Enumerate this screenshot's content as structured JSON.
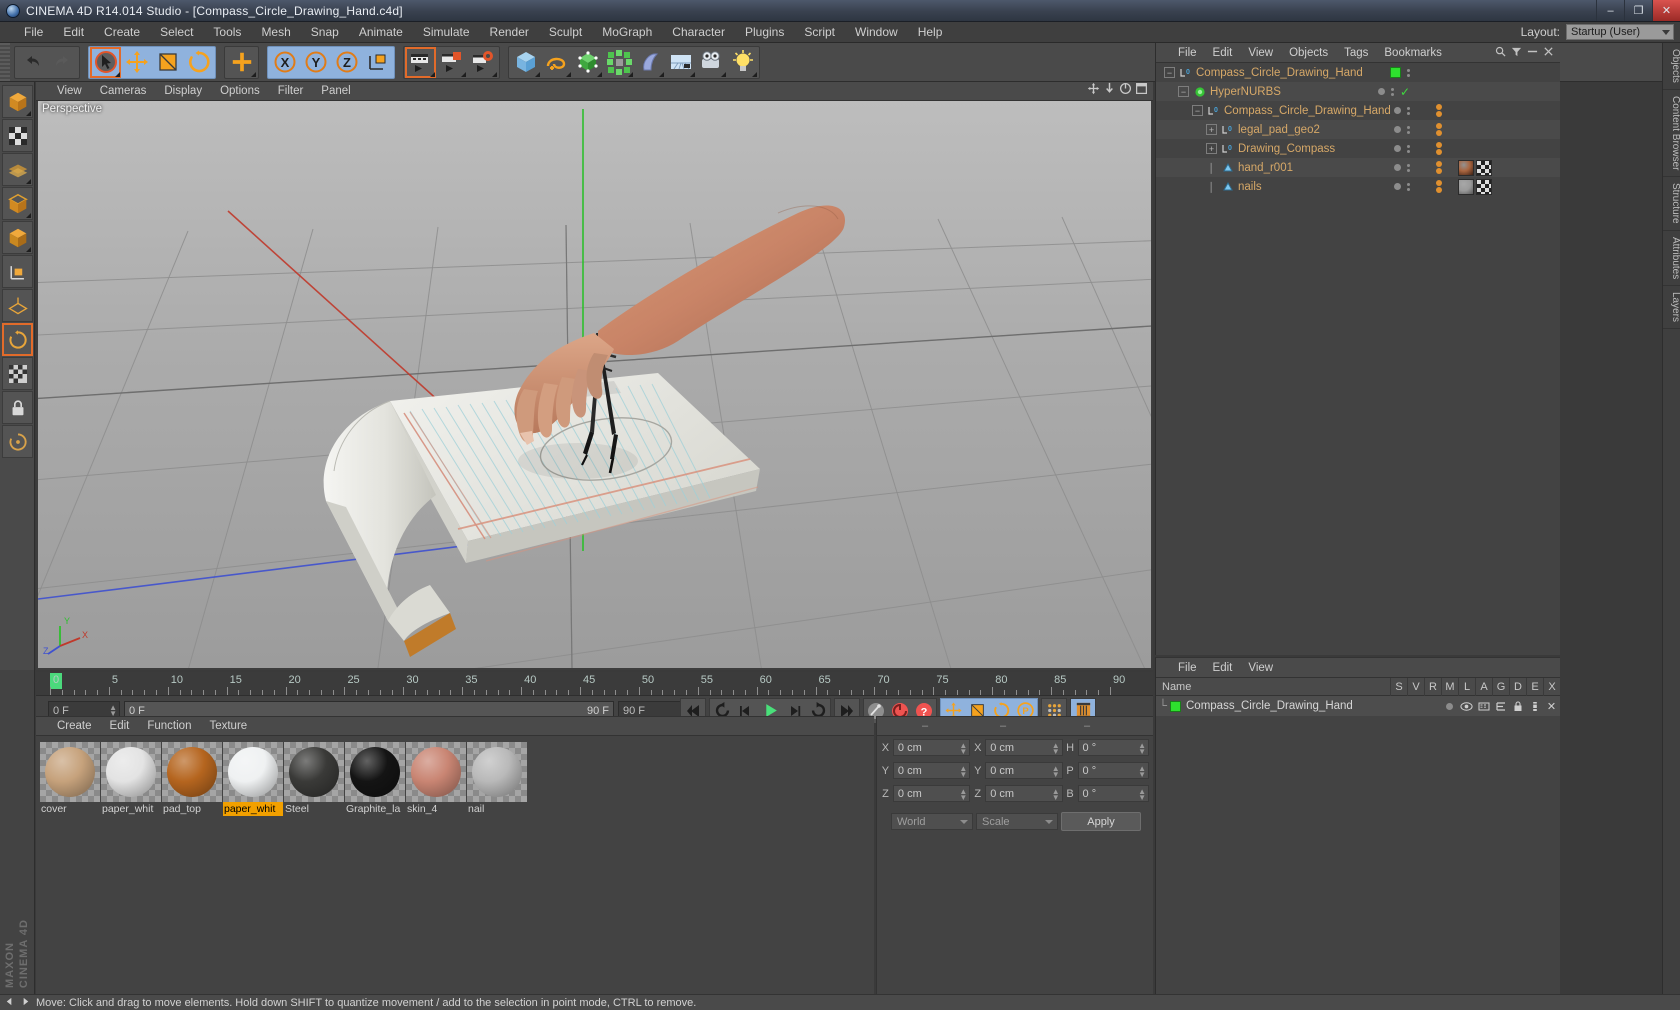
{
  "window": {
    "title": "CINEMA 4D R14.014 Studio - [Compass_Circle_Drawing_Hand.c4d]",
    "app_icon": "c4d-logo-icon",
    "minimize": "–",
    "maximize": "❐",
    "close": "✕"
  },
  "menubar": {
    "items": [
      "File",
      "Edit",
      "Create",
      "Select",
      "Tools",
      "Mesh",
      "Snap",
      "Animate",
      "Simulate",
      "Render",
      "Sculpt",
      "MoGraph",
      "Character",
      "Plugins",
      "Script",
      "Window",
      "Help"
    ],
    "layout_label": "Layout:",
    "layout_value": "Startup (User)"
  },
  "toolbar": {
    "groups": [
      {
        "name": "undo-redo",
        "buttons": [
          {
            "icon": "undo-icon"
          },
          {
            "icon": "redo-icon"
          }
        ]
      },
      {
        "name": "transform",
        "highlight": true,
        "buttons": [
          {
            "icon": "live-selection-icon",
            "selected": true
          },
          {
            "icon": "move-icon"
          },
          {
            "icon": "scale-icon"
          },
          {
            "icon": "rotate-icon"
          }
        ]
      },
      {
        "name": "add-point",
        "buttons": [
          {
            "icon": "plus-move-icon"
          }
        ]
      },
      {
        "name": "axis-lock",
        "highlight": true,
        "buttons": [
          {
            "icon": "x-axis-icon"
          },
          {
            "icon": "y-axis-icon"
          },
          {
            "icon": "z-axis-icon"
          },
          {
            "icon": "world-axis-icon"
          }
        ]
      },
      {
        "name": "render",
        "buttons": [
          {
            "icon": "render-view-icon",
            "selected": true
          },
          {
            "icon": "render-picture-viewer-icon"
          },
          {
            "icon": "render-settings-icon"
          }
        ]
      },
      {
        "name": "create",
        "buttons": [
          {
            "icon": "cube-primitive-icon"
          },
          {
            "icon": "spline-icon"
          },
          {
            "icon": "nurbs-icon"
          },
          {
            "icon": "mograph-icon"
          },
          {
            "icon": "deformer-icon"
          },
          {
            "icon": "scene-icon"
          },
          {
            "icon": "camera-icon"
          },
          {
            "icon": "light-icon"
          }
        ]
      }
    ]
  },
  "left_palette": {
    "buttons": [
      {
        "icon": "model-mode-icon",
        "selected": false
      },
      {
        "icon": "texture-mode-icon",
        "selected": false
      },
      {
        "icon": "points-mode-icon",
        "selected": false
      },
      {
        "icon": "edges-mode-icon",
        "selected": false
      },
      {
        "icon": "polygons-mode-icon",
        "selected": false
      },
      {
        "icon": "object-axis-icon",
        "selected": false
      },
      {
        "icon": "workplane-icon",
        "selected": false
      },
      {
        "icon": "enable-axis-icon",
        "selected": true
      },
      {
        "icon": "viewport-solo-icon",
        "selected": false
      },
      {
        "icon": "lock-icon",
        "selected": false
      },
      {
        "icon": "snap-icon",
        "selected": false
      }
    ]
  },
  "viewport": {
    "menu": [
      "View",
      "Cameras",
      "Display",
      "Options",
      "Filter",
      "Panel"
    ],
    "view_label": "Perspective",
    "corner_icons": [
      "move-camera-icon",
      "dolly-camera-icon",
      "rotate-camera-icon",
      "maximize-view-icon"
    ],
    "axis_labels": {
      "x": "X",
      "y": "Y",
      "z": "Z"
    }
  },
  "timeline": {
    "ticks": [
      0,
      5,
      10,
      15,
      20,
      25,
      30,
      35,
      40,
      45,
      50,
      55,
      60,
      65,
      70,
      75,
      80,
      85,
      90
    ],
    "current_frame": "0 F",
    "range_start": "0 F",
    "range_end": "90 F",
    "max_frame": "90 F",
    "transport": [
      {
        "icon": "go-to-start-icon"
      },
      {
        "icon": "play-backwards-icon"
      },
      {
        "icon": "step-back-icon"
      },
      {
        "icon": "play-forward-icon"
      },
      {
        "icon": "step-forward-icon"
      },
      {
        "icon": "loop-icon"
      },
      {
        "icon": "go-to-end-icon"
      },
      {
        "icon": "record-active-objects-icon"
      },
      {
        "icon": "autokeying-icon"
      },
      {
        "icon": "keyframe-selection-icon"
      },
      {
        "icon": "record-position-icon"
      },
      {
        "icon": "record-scale-icon"
      },
      {
        "icon": "record-rotation-icon"
      },
      {
        "icon": "record-param-icon"
      },
      {
        "icon": "point-level-animation-icon"
      },
      {
        "icon": "timeline-icon"
      }
    ]
  },
  "material_manager": {
    "menu": [
      "Create",
      "Edit",
      "Function",
      "Texture"
    ],
    "materials": [
      {
        "name": "cover",
        "color": "#c6a27c",
        "selected": false
      },
      {
        "name": "paper_whit",
        "color": "#e3e3e3",
        "selected": false
      },
      {
        "name": "pad_top",
        "color": "#b5651f",
        "selected": false
      },
      {
        "name": "paper_whit",
        "color": "#eff1f2",
        "selected": true
      },
      {
        "name": "Steel",
        "color": "#3a3a38",
        "selected": false
      },
      {
        "name": "Graphite_lа",
        "color": "#141414",
        "selected": false
      },
      {
        "name": "skin_4",
        "color": "#c98573",
        "selected": false
      },
      {
        "name": "nail",
        "color": "#b9b9b9",
        "selected": false
      }
    ]
  },
  "coordinates": {
    "header_cols": [
      "–",
      "–",
      "–"
    ],
    "rows": [
      {
        "label1": "X",
        "value1": "0 cm",
        "label2": "X",
        "value2": "0 cm",
        "label3": "H",
        "value3": "0 °"
      },
      {
        "label1": "Y",
        "value1": "0 cm",
        "label2": "Y",
        "value2": "0 cm",
        "label3": "P",
        "value3": "0 °"
      },
      {
        "label1": "Z",
        "value1": "0 cm",
        "label2": "Z",
        "value2": "0 cm",
        "label3": "B",
        "value3": "0 °"
      }
    ],
    "system": "World",
    "mode": "Scale",
    "apply": "Apply"
  },
  "object_manager": {
    "menu": [
      "File",
      "Edit",
      "View",
      "Objects",
      "Tags",
      "Bookmarks"
    ],
    "header_icons": [
      "search-icon",
      "filter-icon",
      "minus-icon",
      "close-icon"
    ],
    "rows": [
      {
        "name": "Compass_Circle_Drawing_Hand",
        "depth": 0,
        "icon": "null-object-icon",
        "expander": "minus",
        "green_box": true,
        "check": false,
        "tagdots": 0,
        "tags": []
      },
      {
        "name": "HyperNURBS",
        "depth": 1,
        "icon": "hypernurbs-icon",
        "expander": "minus",
        "green_box": false,
        "check": true,
        "tagdots": 0,
        "tags": []
      },
      {
        "name": "Compass_Circle_Drawing_Hand",
        "depth": 2,
        "icon": "null-object-icon",
        "expander": "minus",
        "green_box": false,
        "check": false,
        "tagdots": 2,
        "tags": []
      },
      {
        "name": "legal_pad_geo2",
        "depth": 3,
        "icon": "null-object-icon",
        "expander": "plus",
        "green_box": false,
        "check": false,
        "tagdots": 2,
        "tags": []
      },
      {
        "name": "Drawing_Compass",
        "depth": 3,
        "icon": "null-object-icon",
        "expander": "plus",
        "green_box": false,
        "check": false,
        "tagdots": 2,
        "tags": []
      },
      {
        "name": "hand_r001",
        "depth": 3,
        "icon": "polygon-object-icon",
        "expander": "none",
        "green_box": false,
        "check": false,
        "tagdots": 2,
        "tags": [
          "material-sphere",
          "checker"
        ]
      },
      {
        "name": "nails",
        "depth": 3,
        "icon": "polygon-object-icon",
        "expander": "none",
        "green_box": false,
        "check": false,
        "tagdots": 2,
        "tags": [
          "material-nail",
          "checker"
        ]
      }
    ]
  },
  "attribute_manager": {
    "menu": [
      "File",
      "Edit",
      "View"
    ],
    "name_col": "Name",
    "columns": [
      "S",
      "V",
      "R",
      "M",
      "L",
      "A",
      "G",
      "D",
      "E",
      "X"
    ],
    "row": {
      "name": "Compass_Circle_Drawing_Hand",
      "icons": [
        "visibility-dot-icon",
        "editor-visible-icon",
        "render-visible-icon",
        "deformer-icon",
        "lock-icon",
        "animate-icon"
      ]
    }
  },
  "right_tabs": [
    "Objects",
    "Content Browser",
    "Structure",
    "Attributes",
    "Layers"
  ],
  "statusbar": {
    "text": "Move: Click and drag to move elements. Hold down SHIFT to quantize movement / add to the selection in point mode, CTRL to remove.",
    "icons": [
      "prev-icon",
      "next-icon"
    ]
  },
  "branding": {
    "line1": "MAXON",
    "line2": "CINEMA 4D"
  },
  "colors": {
    "accent_orange": "#e0902f",
    "highlight_blue": "#8fb2dd",
    "select_orange": "#f2a000",
    "green": "#2ee02e",
    "panel_bg": "#434343",
    "toolbar_bg": "#4a4a4a"
  }
}
